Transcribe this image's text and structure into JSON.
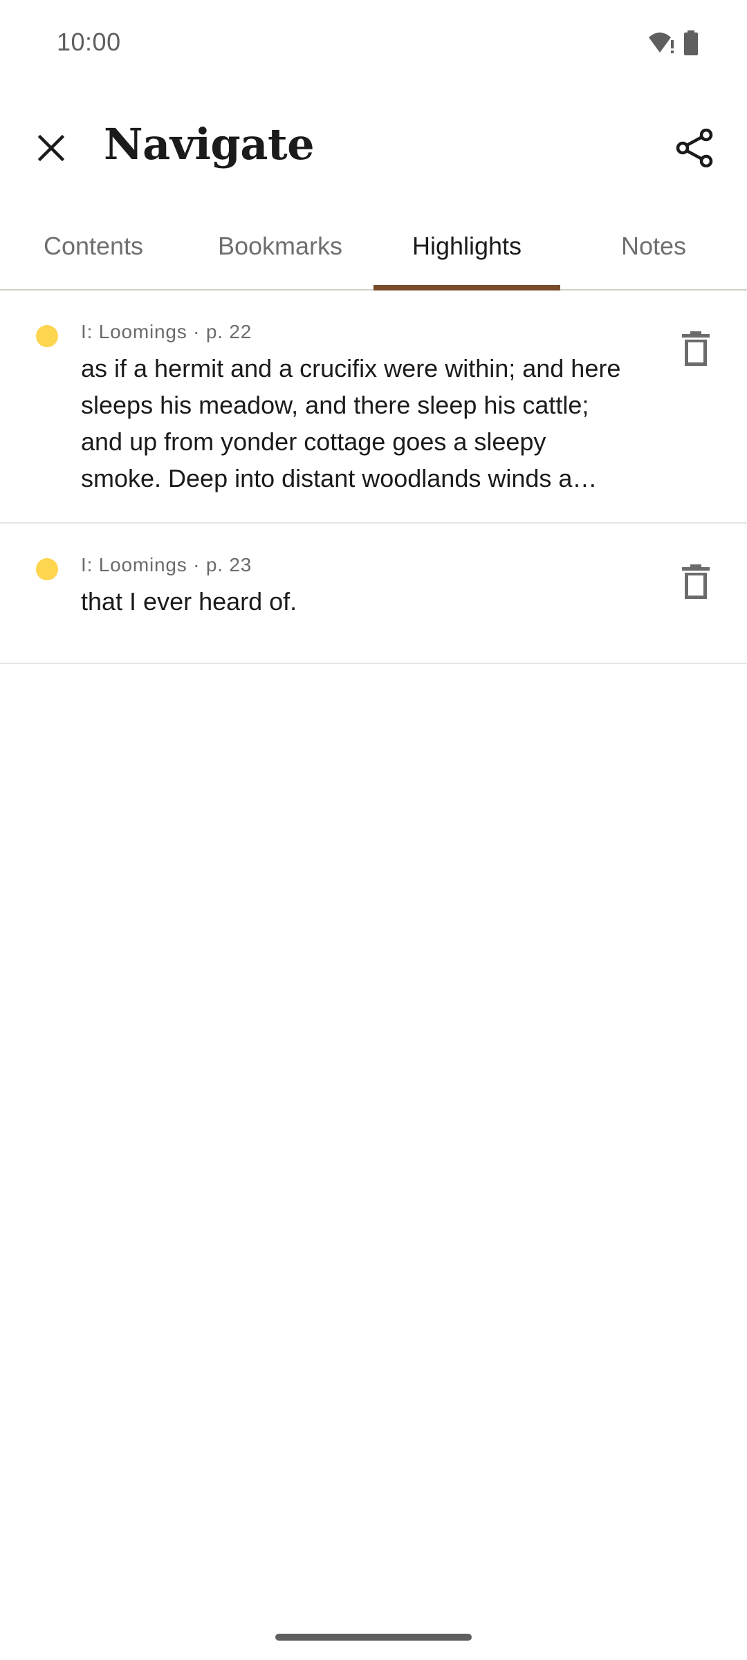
{
  "status_bar": {
    "time": "10:00",
    "icons": [
      "wifi-alert-icon",
      "battery-icon"
    ]
  },
  "app_bar": {
    "title": "Navigate",
    "close_icon": "close-icon",
    "share_icon": "share-icon"
  },
  "tabs": [
    {
      "label": "Contents",
      "active": false
    },
    {
      "label": "Bookmarks",
      "active": false
    },
    {
      "label": "Highlights",
      "active": true
    },
    {
      "label": "Notes",
      "active": false
    }
  ],
  "highlights": [
    {
      "meta": "I: Loomings · p. 22",
      "text": "as if a hermit and a crucifix were within; and here sleeps his meadow, and there sleep his cattle; and up from yonder cottage goes a sleepy smoke. Deep into distant woodlands winds a mazy way",
      "color": "#FDD54F"
    },
    {
      "meta": "I: Loomings · p. 23",
      "text": "that I ever heard of.",
      "color": "#FDD54F"
    }
  ],
  "colors": {
    "accent": "#7A4A2C",
    "highlight_yellow": "#FDD54F",
    "text_primary": "#1B1B1B",
    "text_secondary": "#6B6B6B"
  }
}
